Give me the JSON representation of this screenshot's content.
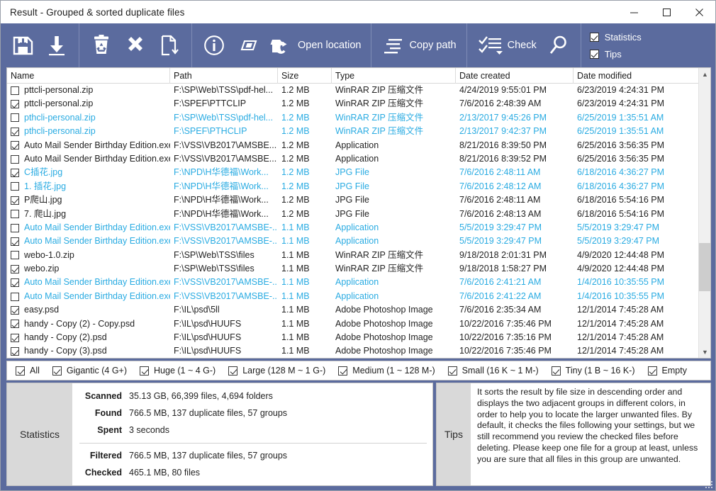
{
  "window": {
    "title": "Result - Grouped & sorted duplicate files",
    "minimize_label": "–",
    "maximize_label": "☐",
    "close_label": "✕"
  },
  "toolbar": {
    "groups": [
      {
        "buttons": [
          {
            "name": "save-button",
            "icon": "save-icon",
            "label": ""
          },
          {
            "name": "export-button",
            "icon": "download-arrow-icon",
            "label": ""
          }
        ]
      },
      {
        "buttons": [
          {
            "name": "recycle-button",
            "icon": "recycle-bin-icon",
            "label": ""
          },
          {
            "name": "delete-button",
            "icon": "close-x-icon",
            "label": ""
          },
          {
            "name": "move-button",
            "icon": "file-move-icon",
            "label": ""
          }
        ]
      },
      {
        "buttons": [
          {
            "name": "properties-button",
            "icon": "info-circle-icon",
            "label": ""
          },
          {
            "name": "rename-button",
            "icon": "rename-tag-icon",
            "label": ""
          },
          {
            "name": "open-location-button",
            "icon": "folder-open-icon",
            "label": "Open location"
          }
        ]
      },
      {
        "buttons": [
          {
            "name": "copy-path-button",
            "icon": "copy-path-icon",
            "label": "Copy path"
          }
        ]
      },
      {
        "buttons": [
          {
            "name": "check-button",
            "icon": "check-list-icon",
            "label": "Check"
          },
          {
            "name": "search-button",
            "icon": "search-icon",
            "label": ""
          }
        ]
      }
    ],
    "toggles": [
      {
        "name": "statistics-toggle",
        "label": "Statistics",
        "checked": true
      },
      {
        "name": "tips-toggle",
        "label": "Tips",
        "checked": true
      }
    ]
  },
  "table": {
    "columns": [
      "Name",
      "Path",
      "Size",
      "Type",
      "Date created",
      "Date modified"
    ],
    "rows": [
      {
        "checked": false,
        "blue": false,
        "name": "pttcli-personal.zip",
        "path": "F:\\SP\\Web\\TSS\\pdf-hel...",
        "size": "1.2 MB",
        "type": "WinRAR ZIP 压缩文件",
        "created": "4/24/2019 9:55:01 PM",
        "modified": "6/23/2019 4:24:31 PM"
      },
      {
        "checked": true,
        "blue": false,
        "name": "pttcli-personal.zip",
        "path": "F:\\SPEF\\PTTCLIP",
        "size": "1.2 MB",
        "type": "WinRAR ZIP 压缩文件",
        "created": "7/6/2016 2:48:39 AM",
        "modified": "6/23/2019 4:24:31 PM"
      },
      {
        "checked": false,
        "blue": true,
        "name": "pthcli-personal.zip",
        "path": "F:\\SP\\Web\\TSS\\pdf-hel...",
        "size": "1.2 MB",
        "type": "WinRAR ZIP 压缩文件",
        "created": "2/13/2017 9:45:26 PM",
        "modified": "6/25/2019 1:35:51 AM"
      },
      {
        "checked": true,
        "blue": true,
        "name": "pthcli-personal.zip",
        "path": "F:\\SPEF\\PTHCLIP",
        "size": "1.2 MB",
        "type": "WinRAR ZIP 压缩文件",
        "created": "2/13/2017 9:42:37 PM",
        "modified": "6/25/2019 1:35:51 AM"
      },
      {
        "checked": true,
        "blue": false,
        "name": "Auto Mail Sender Birthday Edition.exe",
        "path": "F:\\VSS\\VB2017\\AMSBE...",
        "size": "1.2 MB",
        "type": "Application",
        "created": "8/21/2016 8:39:50 PM",
        "modified": "6/25/2016 3:56:35 PM"
      },
      {
        "checked": false,
        "blue": false,
        "name": "Auto Mail Sender Birthday Edition.exe",
        "path": "F:\\VSS\\VB2017\\AMSBE...",
        "size": "1.2 MB",
        "type": "Application",
        "created": "8/21/2016 8:39:52 PM",
        "modified": "6/25/2016 3:56:35 PM"
      },
      {
        "checked": true,
        "blue": true,
        "name": "C插花.jpg",
        "path": "F:\\NPD\\H华德福\\Work...",
        "size": "1.2 MB",
        "type": "JPG File",
        "created": "7/6/2016 2:48:11 AM",
        "modified": "6/18/2016 4:36:27 PM"
      },
      {
        "checked": false,
        "blue": true,
        "name": "1. 插花.jpg",
        "path": "F:\\NPD\\H华德福\\Work...",
        "size": "1.2 MB",
        "type": "JPG File",
        "created": "7/6/2016 2:48:12 AM",
        "modified": "6/18/2016 4:36:27 PM"
      },
      {
        "checked": true,
        "blue": false,
        "name": "P爬山.jpg",
        "path": "F:\\NPD\\H华德福\\Work...",
        "size": "1.2 MB",
        "type": "JPG File",
        "created": "7/6/2016 2:48:11 AM",
        "modified": "6/18/2016 5:54:16 PM"
      },
      {
        "checked": false,
        "blue": false,
        "name": "7. 爬山.jpg",
        "path": "F:\\NPD\\H华德福\\Work...",
        "size": "1.2 MB",
        "type": "JPG File",
        "created": "7/6/2016 2:48:13 AM",
        "modified": "6/18/2016 5:54:16 PM"
      },
      {
        "checked": false,
        "blue": true,
        "name": "Auto Mail Sender Birthday Edition.exe",
        "path": "F:\\VSS\\VB2017\\AMSBE-...",
        "size": "1.1 MB",
        "type": "Application",
        "created": "5/5/2019 3:29:47 PM",
        "modified": "5/5/2019 3:29:47 PM"
      },
      {
        "checked": true,
        "blue": true,
        "name": "Auto Mail Sender Birthday Edition.exe",
        "path": "F:\\VSS\\VB2017\\AMSBE-...",
        "size": "1.1 MB",
        "type": "Application",
        "created": "5/5/2019 3:29:47 PM",
        "modified": "5/5/2019 3:29:47 PM"
      },
      {
        "checked": false,
        "blue": false,
        "name": "webo-1.0.zip",
        "path": "F:\\SP\\Web\\TSS\\files",
        "size": "1.1 MB",
        "type": "WinRAR ZIP 压缩文件",
        "created": "9/18/2018 2:01:31 PM",
        "modified": "4/9/2020 12:44:48 PM"
      },
      {
        "checked": true,
        "blue": false,
        "name": "webo.zip",
        "path": "F:\\SP\\Web\\TSS\\files",
        "size": "1.1 MB",
        "type": "WinRAR ZIP 压缩文件",
        "created": "9/18/2018 1:58:27 PM",
        "modified": "4/9/2020 12:44:48 PM"
      },
      {
        "checked": true,
        "blue": true,
        "name": "Auto Mail Sender Birthday Edition.exe",
        "path": "F:\\VSS\\VB2017\\AMSBE-...",
        "size": "1.1 MB",
        "type": "Application",
        "created": "7/6/2016 2:41:21 AM",
        "modified": "1/4/2016 10:35:55 PM"
      },
      {
        "checked": false,
        "blue": true,
        "name": "Auto Mail Sender Birthday Edition.exe",
        "path": "F:\\VSS\\VB2017\\AMSBE-...",
        "size": "1.1 MB",
        "type": "Application",
        "created": "7/6/2016 2:41:22 AM",
        "modified": "1/4/2016 10:35:55 PM"
      },
      {
        "checked": true,
        "blue": false,
        "name": "easy.psd",
        "path": "F:\\IL\\psd\\5ll",
        "size": "1.1 MB",
        "type": "Adobe Photoshop Image",
        "created": "7/6/2016 2:35:34 AM",
        "modified": "12/1/2014 7:45:28 AM"
      },
      {
        "checked": true,
        "blue": false,
        "name": "handy - Copy (2) - Copy.psd",
        "path": "F:\\IL\\psd\\HUUFS",
        "size": "1.1 MB",
        "type": "Adobe Photoshop Image",
        "created": "10/22/2016 7:35:46 PM",
        "modified": "12/1/2014 7:45:28 AM"
      },
      {
        "checked": true,
        "blue": false,
        "name": "handy - Copy (2).psd",
        "path": "F:\\IL\\psd\\HUUFS",
        "size": "1.1 MB",
        "type": "Adobe Photoshop Image",
        "created": "10/22/2016 7:35:16 PM",
        "modified": "12/1/2014 7:45:28 AM"
      },
      {
        "checked": true,
        "blue": false,
        "name": "handy - Copy (3).psd",
        "path": "F:\\IL\\psd\\HUUFS",
        "size": "1.1 MB",
        "type": "Adobe Photoshop Image",
        "created": "10/22/2016 7:35:46 PM",
        "modified": "12/1/2014 7:45:28 AM"
      }
    ]
  },
  "size_filters": [
    {
      "label": "All",
      "checked": true
    },
    {
      "label": "Gigantic (4 G+)",
      "checked": true
    },
    {
      "label": "Huge (1 ~ 4 G-)",
      "checked": true
    },
    {
      "label": "Large (128 M ~ 1 G-)",
      "checked": true
    },
    {
      "label": "Medium (1 ~ 128 M-)",
      "checked": true
    },
    {
      "label": "Small (16 K ~ 1 M-)",
      "checked": true
    },
    {
      "label": "Tiny (1 B ~ 16 K-)",
      "checked": true
    },
    {
      "label": "Empty",
      "checked": true
    }
  ],
  "statistics": {
    "tab_label": "Statistics",
    "group1": [
      {
        "label": "Scanned",
        "value": "35.13 GB, 66,399 files, 4,694 folders"
      },
      {
        "label": "Found",
        "value": "766.5 MB, 137 duplicate files, 57 groups"
      },
      {
        "label": "Spent",
        "value": "3 seconds"
      }
    ],
    "group2": [
      {
        "label": "Filtered",
        "value": "766.5 MB, 137 duplicate files, 57 groups"
      },
      {
        "label": "Checked",
        "value": "465.1 MB, 80 files"
      }
    ]
  },
  "tips": {
    "tab_label": "Tips",
    "text": "It sorts the result by file size in descending order and displays the two adjacent groups in different colors, in order to help you to locate the larger unwanted files. By default, it checks the files following your settings, but we still recommend you review the checked files before deleting. Please keep one file for a group at least, unless you are sure that all files in this group are unwanted."
  },
  "colors": {
    "toolbar_blue": "#5b6b9e",
    "accent_row_blue": "#29abe2",
    "panel_tab_gray": "#d9d9d9"
  }
}
